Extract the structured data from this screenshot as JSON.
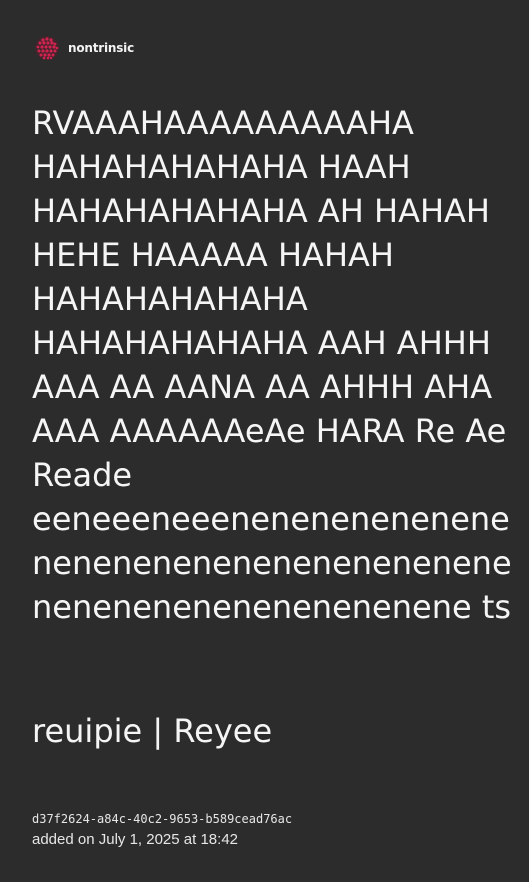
{
  "brand": {
    "name": "nontrinsic",
    "logo_icon": "pink-dot-cluster-icon",
    "logo_color": "#d0234f"
  },
  "quote": {
    "text": "RVAAAHAAAAAAAAAHA HAHAHAHAHAHA HAAH HAHAHAHAHAHA AH HAHAH HEHE HAAAAA HAHAH HAHAHAHAHAHA HAHAHAHAHAHA AAH AHHH AAA AA AANA AA AHHH AHA AAA AAAAAAeAe HARA Re Ae Reade eeneeeneeenenenenenenenenenenenenenenenenenenenenenenenenenenenenenene ts"
  },
  "attribution": {
    "text": "reuipie | Reyee"
  },
  "meta": {
    "uuid": "d37f2624-a84c-40c2-9653-b589cead76ac",
    "added": "added on July 1, 2025 at 18:42"
  },
  "colors": {
    "background": "#2c2c2c",
    "text": "#f5f5f5"
  }
}
